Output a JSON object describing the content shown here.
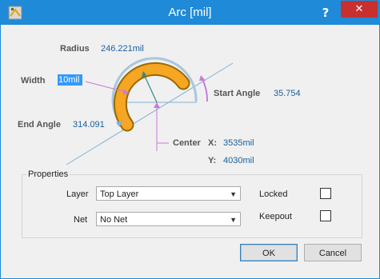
{
  "window": {
    "title": "Arc [mil]",
    "help_label": "?",
    "close_label": "✕"
  },
  "diagram": {
    "radius_label": "Radius",
    "radius_value": "246.221mil",
    "width_label": "Width",
    "width_value": "10mil",
    "start_angle_label": "Start Angle",
    "start_angle_value": "35.754",
    "end_angle_label": "End Angle",
    "end_angle_value": "314.091",
    "center_label": "Center",
    "x_label": "X:",
    "x_value": "3535mil",
    "y_label": "Y:",
    "y_value": "4030mil"
  },
  "properties": {
    "title": "Properties",
    "layer_label": "Layer",
    "layer_value": "Top Layer",
    "net_label": "Net",
    "net_value": "No Net",
    "locked_label": "Locked",
    "keepout_label": "Keepout"
  },
  "buttons": {
    "ok": "OK",
    "cancel": "Cancel"
  },
  "colors": {
    "titlebar": "#1e8ad8",
    "arc": "#f5a623",
    "value_text": "#1a5e9c",
    "angle_marker": "#c77dd8"
  }
}
